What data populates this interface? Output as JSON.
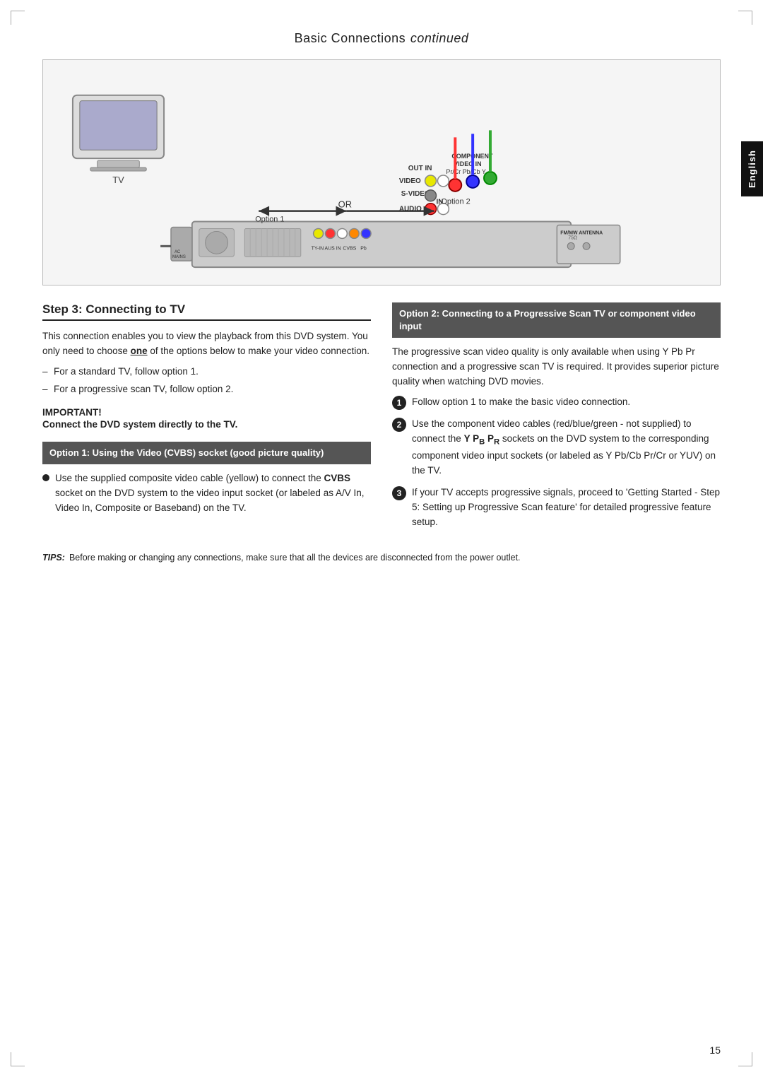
{
  "page": {
    "title": "Basic Connections",
    "title_suffix": "continued",
    "english_tab": "English",
    "page_number": "15"
  },
  "step3": {
    "heading": "Step 3: Connecting to TV",
    "intro": "This connection enables you to view the playback from this DVD system. You only need to choose one of the options below to make your video connection.",
    "bullets": [
      "For a standard TV, follow option 1.",
      "For a progressive scan TV, follow option 2."
    ],
    "important_label": "IMPORTANT!",
    "important_text": "Connect the DVD system directly to the TV.",
    "option1_title": "Option 1: Using the Video (CVBS) socket (good picture quality)",
    "option1_body": "Use the supplied composite video cable (yellow) to connect the CVBS socket on the DVD system to the video input socket (or labeled as A/V In, Video In, Composite or Baseband) on the TV."
  },
  "option2": {
    "title": "Option 2: Connecting to a Progressive Scan TV or component video input",
    "intro": "The progressive scan video quality is only available when using Y Pb Pr connection and a progressive scan TV is required. It provides superior picture quality when watching DVD movies.",
    "numbered_items": [
      "Follow option 1 to make the basic video connection.",
      "Use the component video cables (red/blue/green - not supplied) to connect the Y PB PR sockets on the DVD system to the corresponding component video input sockets (or labeled as Y Pb/Cb Pr/Cr or YUV) on the TV.",
      "If your TV accepts progressive signals, proceed to 'Getting Started - Step 5: Setting up Progressive Scan feature' for detailed progressive feature setup."
    ]
  },
  "tips": {
    "label": "TIPS:",
    "text": "Before making or changing any connections, make sure that all the devices are disconnected from the power outlet."
  }
}
